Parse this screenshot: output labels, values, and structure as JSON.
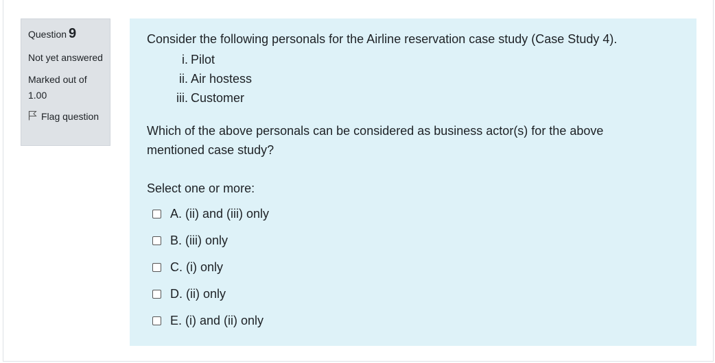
{
  "info": {
    "question_label": "Question",
    "question_number": "9",
    "state": "Not yet answered",
    "grade": "Marked out of 1.00",
    "flag_label": "Flag question"
  },
  "question": {
    "intro": "Consider the following personals for the Airline reservation case study (Case Study 4).",
    "items": [
      {
        "numeral": "i.",
        "text": "Pilot"
      },
      {
        "numeral": "ii.",
        "text": "Air hostess"
      },
      {
        "numeral": "iii.",
        "text": "Customer"
      }
    ],
    "ask": "Which of the above personals can be considered as business actor(s) for the above mentioned case study?",
    "prompt": "Select one or more:",
    "options": [
      {
        "label": "A. (ii) and (iii) only",
        "checked": false
      },
      {
        "label": "B. (iii) only",
        "checked": false
      },
      {
        "label": "C. (i) only",
        "checked": false
      },
      {
        "label": "D. (ii) only",
        "checked": false
      },
      {
        "label": "E. (i) and (ii) only",
        "checked": false
      }
    ]
  }
}
